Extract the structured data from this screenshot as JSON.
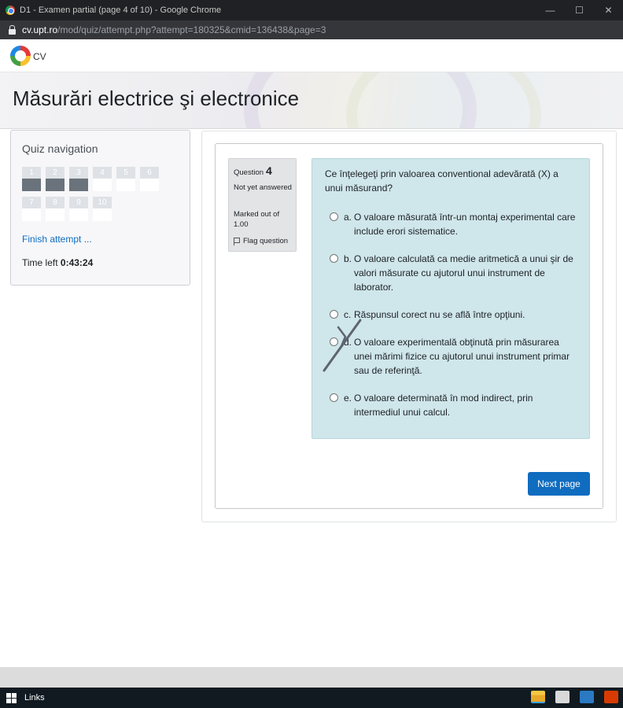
{
  "browser": {
    "window_title": "D1 - Examen partial (page 4 of 10) - Google Chrome",
    "minimize_glyph": "—",
    "maximize_glyph": "☐",
    "close_glyph": "✕",
    "url_host": "cv.upt.ro",
    "url_path": "/mod/quiz/attempt.php?attempt=180325&cmid=136438&page=3"
  },
  "site": {
    "logo_text": "CV",
    "course_title": "Măsurări electrice şi electronice"
  },
  "quiz_nav": {
    "title": "Quiz navigation",
    "questions": [
      {
        "number": "1",
        "answered": true
      },
      {
        "number": "2",
        "answered": true
      },
      {
        "number": "3",
        "answered": true
      },
      {
        "number": "4",
        "answered": false
      },
      {
        "number": "5",
        "answered": false
      },
      {
        "number": "6",
        "answered": false
      },
      {
        "number": "7",
        "answered": false
      },
      {
        "number": "8",
        "answered": false
      },
      {
        "number": "9",
        "answered": false
      },
      {
        "number": "10",
        "answered": false
      }
    ],
    "finish_link": "Finish attempt ...",
    "time_left_label": "Time left",
    "time_left_value": "0:43:24"
  },
  "question": {
    "label": "Question",
    "number": "4",
    "state": "Not yet answered",
    "grade": "Marked out of 1.00",
    "flag_label": "Flag question",
    "text": "Ce înţelegeţi prin valoarea conventional adevărată (X) a unui măsurand?",
    "answers": [
      {
        "letter": "a.",
        "text": "O valoare măsurată într-un montaj experimental care include erori sistematice."
      },
      {
        "letter": "b.",
        "text": "O valoare calculată ca medie aritmetică a unui şir de valori măsurate cu ajutorul unui instrument de laborator."
      },
      {
        "letter": "c.",
        "text": "Răspunsul corect nu se află între opţiuni."
      },
      {
        "letter": "d.",
        "text": "O valoare experimentală obţinută prin măsurarea unei mărimi fizice cu ajutorul unui instrument primar sau de referinţă."
      },
      {
        "letter": "e.",
        "text": "O valoare determinată în mod indirect, prin intermediul unui calcul."
      }
    ]
  },
  "actions": {
    "next_page": "Next page"
  },
  "taskbar": {
    "links_label": "Links"
  }
}
